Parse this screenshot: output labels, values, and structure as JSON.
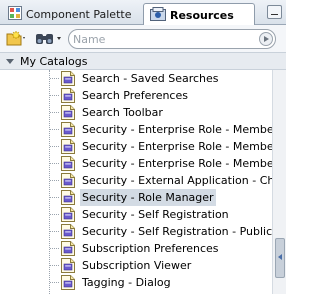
{
  "tabs": [
    {
      "label": "Component Palette",
      "icon": "grid-icon",
      "active": false
    },
    {
      "label": "Resources",
      "icon": "resources-icon",
      "active": true
    }
  ],
  "toolbar": {
    "search_placeholder": "Name",
    "new_icon": "new-folder-icon",
    "binoculars_icon": "binoculars-icon"
  },
  "section": {
    "label": "My Catalogs"
  },
  "tree": {
    "items": [
      {
        "label": "Search - Saved Searches"
      },
      {
        "label": "Search Preferences"
      },
      {
        "label": "Search Toolbar"
      },
      {
        "label": "Security - Enterprise Role - Member"
      },
      {
        "label": "Security - Enterprise Role - Member"
      },
      {
        "label": "Security - Enterprise Role - Member"
      },
      {
        "label": "Security - External Application - Ch"
      },
      {
        "label": "Security - Role Manager",
        "selected": true
      },
      {
        "label": "Security - Self Registration"
      },
      {
        "label": "Security - Self Registration - Public"
      },
      {
        "label": "Subscription Preferences"
      },
      {
        "label": "Subscription Viewer"
      },
      {
        "label": "Tagging - Dialog"
      }
    ]
  },
  "colors": {
    "selection": "#d3dbe4",
    "tab_bar": "#dfe6ee",
    "accent": "#4a6ea8"
  }
}
